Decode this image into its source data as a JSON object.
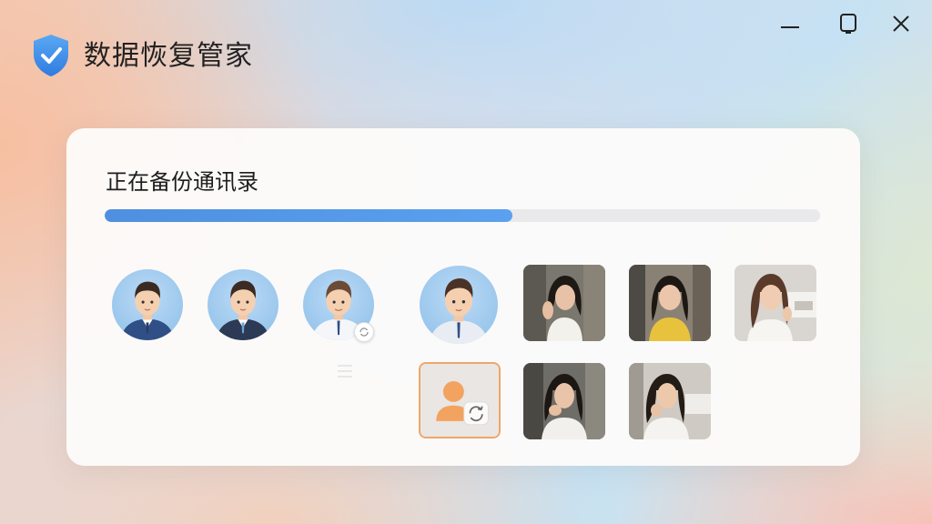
{
  "app": {
    "title": "数据恢复管家",
    "logo_icon": "shield-check-icon"
  },
  "window_controls": {
    "minimize_icon": "minimize-icon",
    "maximize_icon": "maximize-icon",
    "close_icon": "close-icon"
  },
  "backup": {
    "status_text": "正在备份通讯录",
    "progress": 0.57
  },
  "contacts": {
    "avatars": [
      {
        "type": "male-avatar"
      },
      {
        "type": "male-avatar"
      },
      {
        "type": "male-avatar",
        "syncing": true
      },
      {
        "type": "male-avatar"
      }
    ],
    "photos": [
      {
        "type": "portrait-photo"
      },
      {
        "type": "portrait-photo"
      },
      {
        "type": "portrait-photo"
      },
      {
        "type": "portrait-photo"
      },
      {
        "type": "portrait-photo"
      }
    ],
    "placeholder": {
      "type": "contact-placeholder",
      "badge_icon": "sync-icon"
    }
  },
  "colors": {
    "accent": "#4f8fe0",
    "track": "#e9e9ec",
    "placeholder_border": "#f0a66a",
    "placeholder_person": "#f2a35f"
  }
}
